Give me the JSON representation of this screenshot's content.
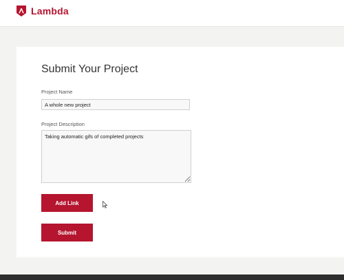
{
  "brand": {
    "name": "Lambda",
    "logo_icon": "lambda-logo-icon",
    "color": "#b5152f"
  },
  "form": {
    "title": "Submit Your Project",
    "project_name": {
      "label": "Project Name",
      "value": "A whole new project"
    },
    "project_description": {
      "label": "Project Description",
      "value": "Taking automatic gifs of completed projects"
    },
    "add_link_label": "Add Link",
    "submit_label": "Submit"
  },
  "cursor_icon": "mouse-pointer-icon"
}
